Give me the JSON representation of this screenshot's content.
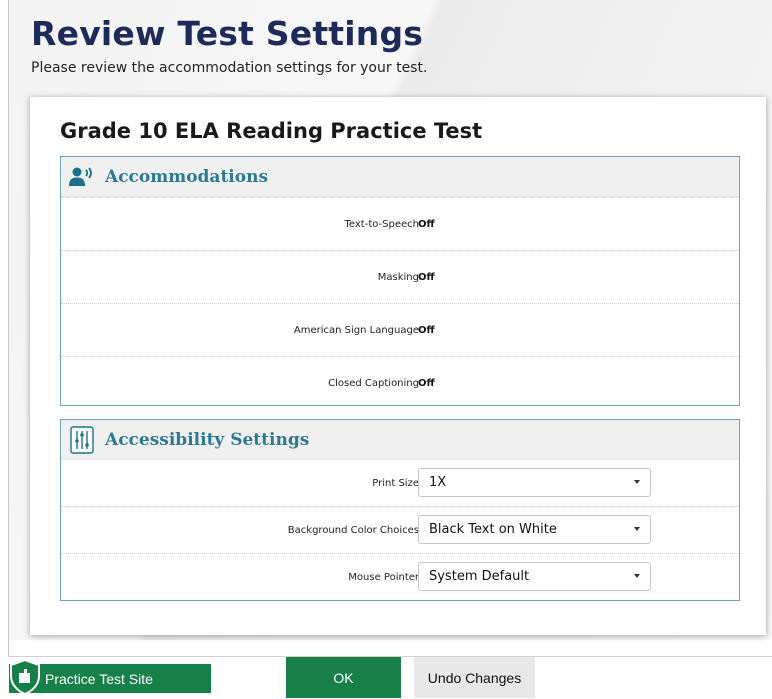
{
  "page": {
    "title": "Review Test Settings",
    "subtitle": "Please review the accommodation settings for your test."
  },
  "test": {
    "name": "Grade 10 ELA Reading Practice Test"
  },
  "accommodations": {
    "title": "Accommodations",
    "icon": "speaking-person-icon",
    "rows": [
      {
        "label": "Text-to-Speech",
        "value": "Off"
      },
      {
        "label": "Masking",
        "value": "Off"
      },
      {
        "label": "American Sign Language",
        "value": "Off"
      },
      {
        "label": "Closed Captioning",
        "value": "Off"
      }
    ]
  },
  "accessibility": {
    "title": "Accessibility Settings",
    "icon": "sliders-icon",
    "rows": [
      {
        "label": "Print Size",
        "value": "1X"
      },
      {
        "label": "Background Color Choices",
        "value": "Black Text on White"
      },
      {
        "label": "Mouse Pointer",
        "value": "System Default"
      }
    ]
  },
  "footer": {
    "practice_label": "Practice Test Site",
    "ok_label": "OK",
    "undo_label": "Undo Changes"
  },
  "colors": {
    "title_navy": "#1d2b5a",
    "section_teal": "#2a7a96",
    "brand_green": "#178048"
  }
}
